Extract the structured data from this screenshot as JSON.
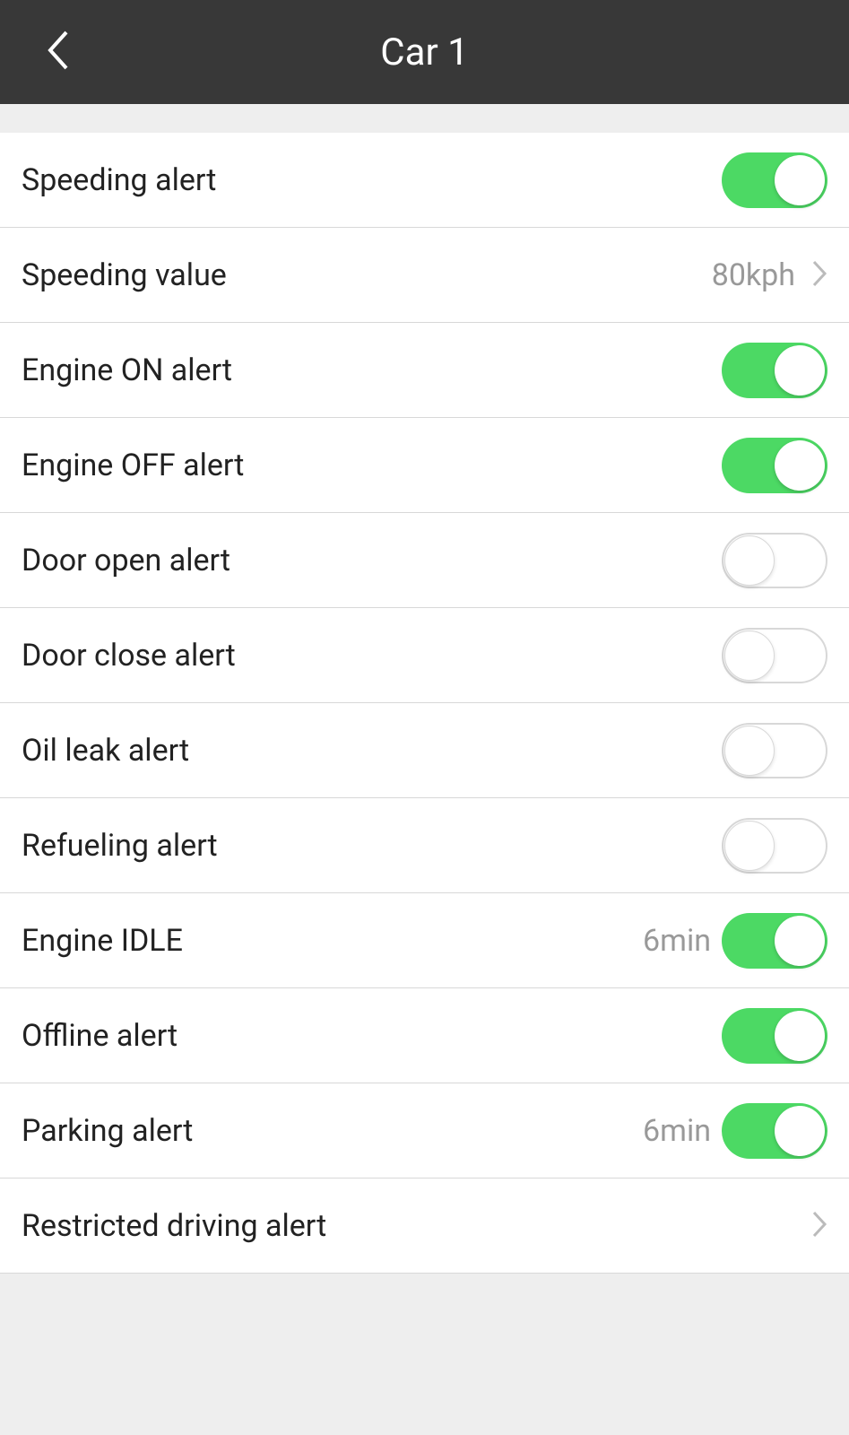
{
  "header": {
    "title": "Car 1"
  },
  "items": [
    {
      "label": "Speeding alert",
      "type": "toggle",
      "on": true
    },
    {
      "label": "Speeding value",
      "type": "link",
      "value": "80kph"
    },
    {
      "label": "Engine ON alert",
      "type": "toggle",
      "on": true
    },
    {
      "label": "Engine OFF alert",
      "type": "toggle",
      "on": true
    },
    {
      "label": "Door open alert",
      "type": "toggle",
      "on": false
    },
    {
      "label": "Door close alert",
      "type": "toggle",
      "on": false
    },
    {
      "label": "Oil leak alert",
      "type": "toggle",
      "on": false
    },
    {
      "label": "Refueling alert",
      "type": "toggle",
      "on": false
    },
    {
      "label": "Engine IDLE",
      "type": "toggle",
      "value": "6min",
      "on": true
    },
    {
      "label": "Offline alert",
      "type": "toggle",
      "on": true
    },
    {
      "label": "Parking alert",
      "type": "toggle",
      "value": "6min",
      "on": true
    },
    {
      "label": "Restricted driving alert",
      "type": "link"
    }
  ]
}
